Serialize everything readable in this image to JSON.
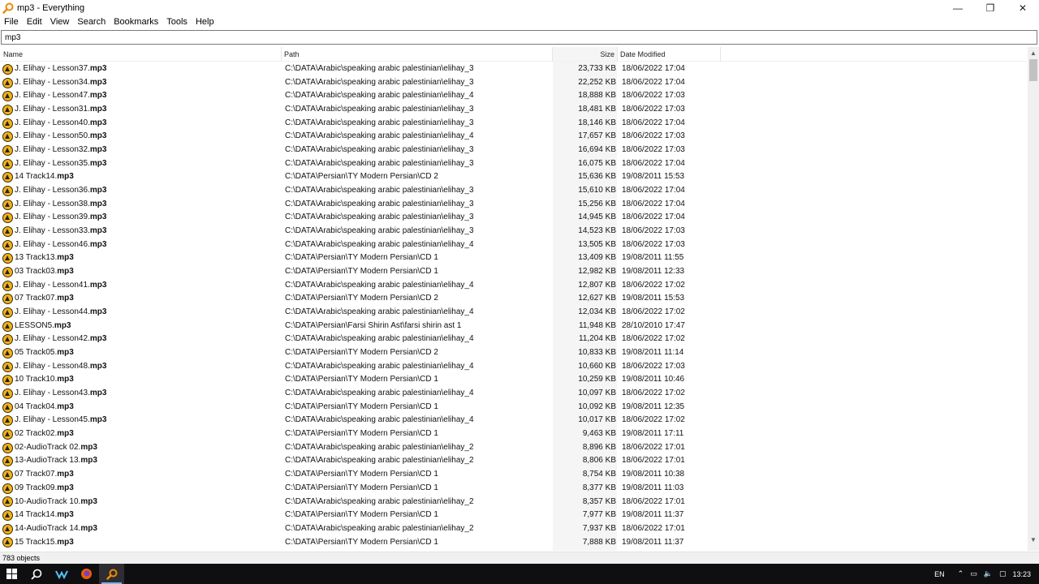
{
  "window": {
    "title": "mp3 - Everything",
    "minimize_glyph": "—",
    "maximize_glyph": "❐",
    "close_glyph": "✕"
  },
  "menu": [
    "File",
    "Edit",
    "View",
    "Search",
    "Bookmarks",
    "Tools",
    "Help"
  ],
  "search": {
    "value": "mp3"
  },
  "columns": {
    "name": "Name",
    "path": "Path",
    "size": "Size",
    "date": "Date Modified"
  },
  "rows": [
    {
      "name": "J. Elihay - Lesson37.",
      "ext": "mp3",
      "path": "C:\\DATA\\Arabic\\speaking arabic palestinian\\elihay_3",
      "size": "23,733 KB",
      "date": "18/06/2022 17:04"
    },
    {
      "name": "J. Elihay - Lesson34.",
      "ext": "mp3",
      "path": "C:\\DATA\\Arabic\\speaking arabic palestinian\\elihay_3",
      "size": "22,252 KB",
      "date": "18/06/2022 17:04"
    },
    {
      "name": "J. Elihay - Lesson47.",
      "ext": "mp3",
      "path": "C:\\DATA\\Arabic\\speaking arabic palestinian\\elihay_4",
      "size": "18,888 KB",
      "date": "18/06/2022 17:03"
    },
    {
      "name": "J. Elihay - Lesson31.",
      "ext": "mp3",
      "path": "C:\\DATA\\Arabic\\speaking arabic palestinian\\elihay_3",
      "size": "18,481 KB",
      "date": "18/06/2022 17:03"
    },
    {
      "name": "J. Elihay - Lesson40.",
      "ext": "mp3",
      "path": "C:\\DATA\\Arabic\\speaking arabic palestinian\\elihay_3",
      "size": "18,146 KB",
      "date": "18/06/2022 17:04"
    },
    {
      "name": "J. Elihay - Lesson50.",
      "ext": "mp3",
      "path": "C:\\DATA\\Arabic\\speaking arabic palestinian\\elihay_4",
      "size": "17,657 KB",
      "date": "18/06/2022 17:03"
    },
    {
      "name": "J. Elihay - Lesson32.",
      "ext": "mp3",
      "path": "C:\\DATA\\Arabic\\speaking arabic palestinian\\elihay_3",
      "size": "16,694 KB",
      "date": "18/06/2022 17:03"
    },
    {
      "name": "J. Elihay - Lesson35.",
      "ext": "mp3",
      "path": "C:\\DATA\\Arabic\\speaking arabic palestinian\\elihay_3",
      "size": "16,075 KB",
      "date": "18/06/2022 17:04"
    },
    {
      "name": "14 Track14.",
      "ext": "mp3",
      "path": "C:\\DATA\\Persian\\TY Modern Persian\\CD 2",
      "size": "15,636 KB",
      "date": "19/08/2011 15:53"
    },
    {
      "name": "J. Elihay - Lesson36.",
      "ext": "mp3",
      "path": "C:\\DATA\\Arabic\\speaking arabic palestinian\\elihay_3",
      "size": "15,610 KB",
      "date": "18/06/2022 17:04"
    },
    {
      "name": "J. Elihay - Lesson38.",
      "ext": "mp3",
      "path": "C:\\DATA\\Arabic\\speaking arabic palestinian\\elihay_3",
      "size": "15,256 KB",
      "date": "18/06/2022 17:04"
    },
    {
      "name": "J. Elihay - Lesson39.",
      "ext": "mp3",
      "path": "C:\\DATA\\Arabic\\speaking arabic palestinian\\elihay_3",
      "size": "14,945 KB",
      "date": "18/06/2022 17:04"
    },
    {
      "name": "J. Elihay - Lesson33.",
      "ext": "mp3",
      "path": "C:\\DATA\\Arabic\\speaking arabic palestinian\\elihay_3",
      "size": "14,523 KB",
      "date": "18/06/2022 17:03"
    },
    {
      "name": "J. Elihay - Lesson46.",
      "ext": "mp3",
      "path": "C:\\DATA\\Arabic\\speaking arabic palestinian\\elihay_4",
      "size": "13,505 KB",
      "date": "18/06/2022 17:03"
    },
    {
      "name": "13 Track13.",
      "ext": "mp3",
      "path": "C:\\DATA\\Persian\\TY Modern Persian\\CD 1",
      "size": "13,409 KB",
      "date": "19/08/2011 11:55"
    },
    {
      "name": "03 Track03.",
      "ext": "mp3",
      "path": "C:\\DATA\\Persian\\TY Modern Persian\\CD 1",
      "size": "12,982 KB",
      "date": "19/08/2011 12:33"
    },
    {
      "name": "J. Elihay - Lesson41.",
      "ext": "mp3",
      "path": "C:\\DATA\\Arabic\\speaking arabic palestinian\\elihay_4",
      "size": "12,807 KB",
      "date": "18/06/2022 17:02"
    },
    {
      "name": "07 Track07.",
      "ext": "mp3",
      "path": "C:\\DATA\\Persian\\TY Modern Persian\\CD 2",
      "size": "12,627 KB",
      "date": "19/08/2011 15:53"
    },
    {
      "name": "J. Elihay - Lesson44.",
      "ext": "mp3",
      "path": "C:\\DATA\\Arabic\\speaking arabic palestinian\\elihay_4",
      "size": "12,034 KB",
      "date": "18/06/2022 17:02"
    },
    {
      "name": "LESSON5.",
      "ext": "mp3",
      "path": "C:\\DATA\\Persian\\Farsi Shirin Ast\\farsi shirin ast 1",
      "size": "11,948 KB",
      "date": "28/10/2010 17:47"
    },
    {
      "name": "J. Elihay - Lesson42.",
      "ext": "mp3",
      "path": "C:\\DATA\\Arabic\\speaking arabic palestinian\\elihay_4",
      "size": "11,204 KB",
      "date": "18/06/2022 17:02"
    },
    {
      "name": "05 Track05.",
      "ext": "mp3",
      "path": "C:\\DATA\\Persian\\TY Modern Persian\\CD 2",
      "size": "10,833 KB",
      "date": "19/08/2011 11:14"
    },
    {
      "name": "J. Elihay - Lesson48.",
      "ext": "mp3",
      "path": "C:\\DATA\\Arabic\\speaking arabic palestinian\\elihay_4",
      "size": "10,660 KB",
      "date": "18/06/2022 17:03"
    },
    {
      "name": "10 Track10.",
      "ext": "mp3",
      "path": "C:\\DATA\\Persian\\TY Modern Persian\\CD 1",
      "size": "10,259 KB",
      "date": "19/08/2011 10:46"
    },
    {
      "name": "J. Elihay - Lesson43.",
      "ext": "mp3",
      "path": "C:\\DATA\\Arabic\\speaking arabic palestinian\\elihay_4",
      "size": "10,097 KB",
      "date": "18/06/2022 17:02"
    },
    {
      "name": "04 Track04.",
      "ext": "mp3",
      "path": "C:\\DATA\\Persian\\TY Modern Persian\\CD 1",
      "size": "10,092 KB",
      "date": "19/08/2011 12:35"
    },
    {
      "name": "J. Elihay - Lesson45.",
      "ext": "mp3",
      "path": "C:\\DATA\\Arabic\\speaking arabic palestinian\\elihay_4",
      "size": "10,017 KB",
      "date": "18/06/2022 17:02"
    },
    {
      "name": "02 Track02.",
      "ext": "mp3",
      "path": "C:\\DATA\\Persian\\TY Modern Persian\\CD 1",
      "size": "9,463 KB",
      "date": "19/08/2011 17:11"
    },
    {
      "name": "02-AudioTrack 02.",
      "ext": "mp3",
      "path": "C:\\DATA\\Arabic\\speaking arabic palestinian\\elihay_2",
      "size": "8,896 KB",
      "date": "18/06/2022 17:01"
    },
    {
      "name": "13-AudioTrack 13.",
      "ext": "mp3",
      "path": "C:\\DATA\\Arabic\\speaking arabic palestinian\\elihay_2",
      "size": "8,806 KB",
      "date": "18/06/2022 17:01"
    },
    {
      "name": "07 Track07.",
      "ext": "mp3",
      "path": "C:\\DATA\\Persian\\TY Modern Persian\\CD 1",
      "size": "8,754 KB",
      "date": "19/08/2011 10:38"
    },
    {
      "name": "09 Track09.",
      "ext": "mp3",
      "path": "C:\\DATA\\Persian\\TY Modern Persian\\CD 1",
      "size": "8,377 KB",
      "date": "19/08/2011 11:03"
    },
    {
      "name": "10-AudioTrack 10.",
      "ext": "mp3",
      "path": "C:\\DATA\\Arabic\\speaking arabic palestinian\\elihay_2",
      "size": "8,357 KB",
      "date": "18/06/2022 17:01"
    },
    {
      "name": "14 Track14.",
      "ext": "mp3",
      "path": "C:\\DATA\\Persian\\TY Modern Persian\\CD 1",
      "size": "7,977 KB",
      "date": "19/08/2011 11:37"
    },
    {
      "name": "14-AudioTrack 14.",
      "ext": "mp3",
      "path": "C:\\DATA\\Arabic\\speaking arabic palestinian\\elihay_2",
      "size": "7,937 KB",
      "date": "18/06/2022 17:01"
    },
    {
      "name": "15 Track15.",
      "ext": "mp3",
      "path": "C:\\DATA\\Persian\\TY Modern Persian\\CD 1",
      "size": "7,888 KB",
      "date": "19/08/2011 11:37"
    }
  ],
  "status": {
    "text": "783 objects"
  },
  "taskbar": {
    "lang": "EN",
    "time": "13:23",
    "apps": [
      "start-icon",
      "search-icon",
      "vscode-icon",
      "firefox-icon",
      "everything-icon"
    ]
  },
  "colors": {
    "accent": "#f2b21b",
    "taskbar": "#0f0f12",
    "size_column_bg": "#f5f5f5"
  }
}
